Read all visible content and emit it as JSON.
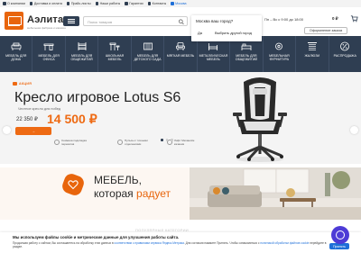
{
  "topbar": {
    "items": [
      "О компании",
      "Доставка и оплата",
      "Прайс-листы",
      "Наши работы",
      "Гарантии",
      "Контакты"
    ],
    "city": "Москва"
  },
  "header": {
    "logo_title": "Аэлита",
    "logo_subtitle": "мебельная фабрика и магазин",
    "search_placeholder": "Поиск товаров",
    "phone_hours": "Пн – Вс с 9:00 до 18:00",
    "cart_total": "0 ₽",
    "order_button": "Оформление заказа"
  },
  "city_popup": {
    "question": "Москва ваш город?",
    "yes": "Да",
    "other": "Выбрать другой город"
  },
  "categories": [
    {
      "label": "Мебель для дома",
      "icon": "sofa-icon"
    },
    {
      "label": "Мебель для офиса",
      "icon": "office-desk-icon"
    },
    {
      "label": "Мебель для общежитий",
      "icon": "bunk-bed-icon"
    },
    {
      "label": "Школьная мебель",
      "icon": "school-desk-icon"
    },
    {
      "label": "Мебель для детского сада",
      "icon": "crib-icon"
    },
    {
      "label": "Мягкая мебель",
      "icon": "armchair-icon"
    },
    {
      "label": "Металлическая мебель",
      "icon": "metal-bed-icon"
    },
    {
      "label": "Мебель для общежитий",
      "icon": "bed-icon"
    },
    {
      "label": "Мебельная фурнитура",
      "icon": "hardware-icon"
    },
    {
      "label": "Жалюзи",
      "icon": "blinds-icon"
    },
    {
      "label": "Распродажа",
      "icon": "percent-icon"
    }
  ],
  "hero": {
    "badge": "АКЦИЯ",
    "title": "Кресло игровое Lotus S6",
    "subtitle": "Честное кресло для побед",
    "old_price": "22 350 ₽",
    "new_price": "14 500 ₽",
    "buy_button": "→",
    "features": [
      "Снижена подкладка перекатов",
      "Пульсы с точными отделениями",
      "Лифт Механизм качания"
    ]
  },
  "banner": {
    "line1": "МЕБЕЛЬ,",
    "line2_prefix": "которая ",
    "line2_accent": "радует"
  },
  "section_hint": "ПОПУЛЯРНЫЕ КАТЕГОРИИ",
  "cookie": {
    "title": "Мы используем файлы cookie и метрические данные для улучшения работы сайта.",
    "text_before": "Продолжая работу с сайтом, Вы соглашаетесь на обработку этих данных в ",
    "link1": "соответствии с правилами сервиса Яндекс.Метрика",
    "text_middle": ". Для согласия нажмите Принять. Чтобы ознакомиться с ",
    "link2": "политикой обработки файлов cookie",
    "text_after": " перейдите в раздел.",
    "accept": "Принять"
  },
  "colors": {
    "accent": "#ee6a13",
    "nav_bg": "#2f3e52",
    "link": "#1e6fd8"
  }
}
